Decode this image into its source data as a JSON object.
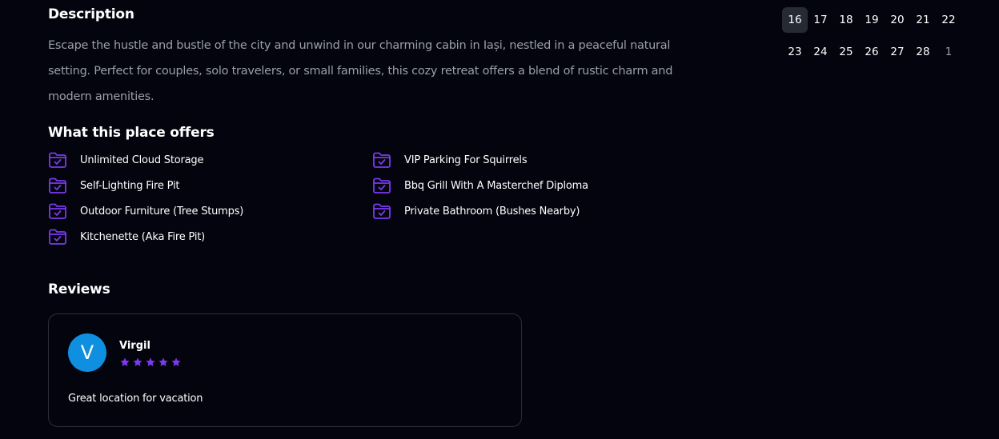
{
  "description": {
    "title": "Description",
    "text": "Escape the hustle and bustle of the city and unwind in our charming cabin in Iași, nestled in a peaceful natural setting. Perfect for couples, solo travelers, or small families, this cozy retreat offers a blend of rustic charm and modern amenities."
  },
  "offers": {
    "title": "What this place offers",
    "icon": "folder-check-icon",
    "items": [
      "Unlimited Cloud Storage",
      "Self-Lighting Fire Pit",
      "Outdoor Furniture (Tree Stumps)",
      "Kitchenette (Aka Fire Pit)",
      "VIP Parking For Squirrels",
      "Bbq Grill With A Masterchef Diploma",
      "Private Bathroom (Bushes Nearby)"
    ]
  },
  "reviews": {
    "title": "Reviews",
    "items": [
      {
        "avatar_letter": "V",
        "name": "Virgil",
        "rating": 5,
        "text": "Great location for vacation"
      }
    ]
  },
  "calendar": {
    "weeks": [
      [
        "16",
        "17",
        "18",
        "19",
        "20",
        "21",
        "22"
      ],
      [
        "23",
        "24",
        "25",
        "26",
        "27",
        "28",
        "1"
      ]
    ],
    "selected": "16"
  },
  "colors": {
    "background": "#03040d",
    "accent": "#7c3aed",
    "avatar": "#0f8fe0",
    "muted_text": "#9a9fac"
  }
}
